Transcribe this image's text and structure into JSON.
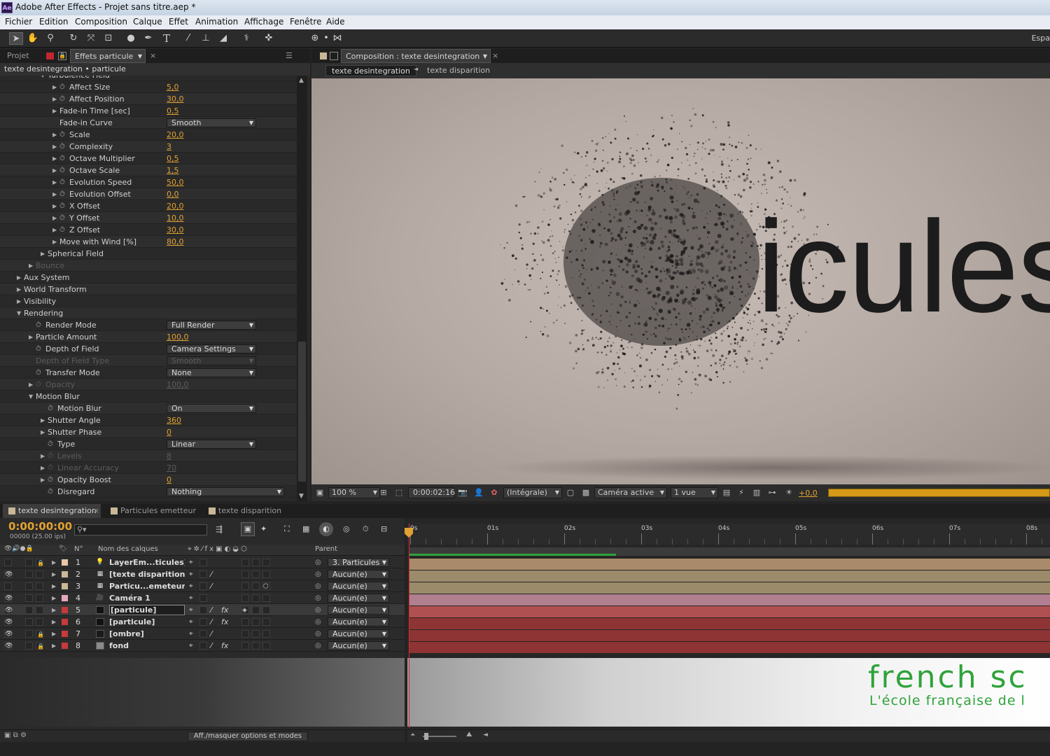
{
  "window": {
    "title": "Adobe After Effects - Projet sans titre.aep *",
    "app_icon": "Ae"
  },
  "menu": [
    "Fichier",
    "Edition",
    "Composition",
    "Calque",
    "Effet",
    "Animation",
    "Affichage",
    "Fenêtre",
    "Aide"
  ],
  "toolbar": {
    "workspace_label": "Espa"
  },
  "effects_panel": {
    "tabs": {
      "project": "Projet",
      "effects": "Effets particule"
    },
    "breadcrumb": "texte desintegration • particule",
    "partial_header": "Turbulence Field",
    "rows": [
      {
        "name": "Affect Size",
        "value": "5,0",
        "kind": "num",
        "indent": 3,
        "stopwatch": true,
        "twirl": true
      },
      {
        "name": "Affect Position",
        "value": "30,0",
        "kind": "num",
        "indent": 3,
        "stopwatch": true,
        "twirl": true
      },
      {
        "name": "Fade-in Time [sec]",
        "value": "0,5",
        "kind": "num",
        "indent": 3,
        "stopwatch": false,
        "twirl": true
      },
      {
        "name": "Fade-in Curve",
        "value": "Smooth",
        "kind": "dd",
        "indent": 3,
        "stopwatch": false,
        "twirl": false
      },
      {
        "name": "Scale",
        "value": "20,0",
        "kind": "num",
        "indent": 3,
        "stopwatch": true,
        "twirl": true
      },
      {
        "name": "Complexity",
        "value": "3",
        "kind": "num",
        "indent": 3,
        "stopwatch": true,
        "twirl": true
      },
      {
        "name": "Octave Multiplier",
        "value": "0,5",
        "kind": "num",
        "indent": 3,
        "stopwatch": true,
        "twirl": true
      },
      {
        "name": "Octave Scale",
        "value": "1,5",
        "kind": "num",
        "indent": 3,
        "stopwatch": true,
        "twirl": true
      },
      {
        "name": "Evolution Speed",
        "value": "50,0",
        "kind": "num",
        "indent": 3,
        "stopwatch": true,
        "twirl": true
      },
      {
        "name": "Evolution Offset",
        "value": "0,0",
        "kind": "num",
        "indent": 3,
        "stopwatch": true,
        "twirl": true
      },
      {
        "name": "X Offset",
        "value": "20,0",
        "kind": "num",
        "indent": 3,
        "stopwatch": true,
        "twirl": true
      },
      {
        "name": "Y Offset",
        "value": "10,0",
        "kind": "num",
        "indent": 3,
        "stopwatch": true,
        "twirl": true
      },
      {
        "name": "Z Offset",
        "value": "30,0",
        "kind": "num",
        "indent": 3,
        "stopwatch": true,
        "twirl": true
      },
      {
        "name": "Move with Wind [%]",
        "value": "80,0",
        "kind": "num",
        "indent": 3,
        "stopwatch": false,
        "twirl": true
      },
      {
        "name": "Spherical Field",
        "value": "",
        "kind": "group",
        "indent": 2,
        "stopwatch": false,
        "twirl": true
      },
      {
        "name": "Bounce",
        "value": "",
        "kind": "group",
        "indent": 1,
        "stopwatch": false,
        "twirl": true,
        "dim": true
      },
      {
        "name": "Aux System",
        "value": "",
        "kind": "group",
        "indent": 0,
        "stopwatch": false,
        "twirl": true
      },
      {
        "name": "World Transform",
        "value": "",
        "kind": "group",
        "indent": 0,
        "stopwatch": false,
        "twirl": true
      },
      {
        "name": "Visibility",
        "value": "",
        "kind": "group",
        "indent": 0,
        "stopwatch": false,
        "twirl": true
      },
      {
        "name": "Rendering",
        "value": "",
        "kind": "group",
        "indent": 0,
        "stopwatch": false,
        "twirl": true,
        "open": true
      },
      {
        "name": "Render Mode",
        "value": "Full Render",
        "kind": "dd",
        "indent": 1,
        "stopwatch": true,
        "twirl": false
      },
      {
        "name": "Particle Amount",
        "value": "100,0",
        "kind": "num",
        "indent": 1,
        "stopwatch": false,
        "twirl": true
      },
      {
        "name": "Depth of Field",
        "value": "Camera Settings",
        "kind": "dd",
        "indent": 1,
        "stopwatch": true,
        "twirl": false
      },
      {
        "name": "Depth of Field Type",
        "value": "Smooth",
        "kind": "dd",
        "indent": 1,
        "stopwatch": false,
        "twirl": false,
        "dim": true
      },
      {
        "name": "Transfer Mode",
        "value": "None",
        "kind": "dd",
        "indent": 1,
        "stopwatch": true,
        "twirl": false
      },
      {
        "name": "Opacity",
        "value": "100,0",
        "kind": "num",
        "indent": 1,
        "stopwatch": true,
        "twirl": true,
        "dim": true
      },
      {
        "name": "Motion Blur",
        "value": "",
        "kind": "group",
        "indent": 1,
        "stopwatch": false,
        "twirl": true,
        "open": true
      },
      {
        "name": "Motion Blur",
        "value": "On",
        "kind": "dd",
        "indent": 2,
        "stopwatch": true,
        "twirl": false
      },
      {
        "name": "Shutter Angle",
        "value": "360",
        "kind": "num",
        "indent": 2,
        "stopwatch": false,
        "twirl": true
      },
      {
        "name": "Shutter Phase",
        "value": "0",
        "kind": "num",
        "indent": 2,
        "stopwatch": false,
        "twirl": true
      },
      {
        "name": "Type",
        "value": "Linear",
        "kind": "dd",
        "indent": 2,
        "stopwatch": true,
        "twirl": false
      },
      {
        "name": "Levels",
        "value": "8",
        "kind": "num",
        "indent": 2,
        "stopwatch": true,
        "twirl": true,
        "dim": true
      },
      {
        "name": "Linear Accuracy",
        "value": "70",
        "kind": "num",
        "indent": 2,
        "stopwatch": true,
        "twirl": true,
        "dim": true
      },
      {
        "name": "Opacity Boost",
        "value": "0",
        "kind": "num",
        "indent": 2,
        "stopwatch": true,
        "twirl": true
      },
      {
        "name": "Disregard",
        "value": "Nothing",
        "kind": "dd",
        "indent": 2,
        "stopwatch": true,
        "twirl": false,
        "wide": true
      }
    ]
  },
  "comp_panel": {
    "tab": "Composition : texte desintegration",
    "crumbs": [
      "texte desintegration",
      "texte disparition"
    ],
    "canvas_text": "icules",
    "zoom": "100 %",
    "timecode": "0:00:02:16",
    "resolution": "(Intégrale)",
    "camera": "Caméra active",
    "views": "1 vue",
    "exposure": "+0,0"
  },
  "timeline": {
    "tabs": [
      "texte desintegration",
      "Particules emetteur",
      "texte disparition"
    ],
    "timecode": "0:00:00:00",
    "fps": "00000 (25.00 ips)",
    "search_placeholder": "",
    "col_num": "N°",
    "col_name": "Nom des calques",
    "col_parent": "Parent",
    "ruler": [
      "0s",
      "01s",
      "02s",
      "03s",
      "04s",
      "05s",
      "06s",
      "07s",
      "08s"
    ],
    "layers": [
      {
        "num": "1",
        "name": "LayerEm...ticules]",
        "icon": "light",
        "parent": "3. Particules",
        "eye": false,
        "locked": true,
        "color": "#e8c8a8",
        "thumb": "",
        "bar": "#a98a6a",
        "fx": false
      },
      {
        "num": "2",
        "name": "[texte disparition]",
        "icon": "comp",
        "parent": "Aucun(e)",
        "eye": true,
        "locked": false,
        "color": "#c9b897",
        "thumb": "",
        "bar": "#9c8b6b",
        "fx": false
      },
      {
        "num": "3",
        "name": "Particu...emeteur",
        "icon": "comp",
        "parent": "Aucun(e)",
        "eye": false,
        "locked": false,
        "color": "#c9b897",
        "thumb": "",
        "bar": "#9c8b6b",
        "fx": false
      },
      {
        "num": "4",
        "name": "Caméra 1",
        "icon": "camera",
        "parent": "Aucun(e)",
        "eye": true,
        "locked": false,
        "color": "#e5a7bd",
        "thumb": "",
        "bar": "#b27f90",
        "fx": false
      },
      {
        "num": "5",
        "name": "[particule]",
        "icon": "solid",
        "parent": "Aucun(e)",
        "eye": true,
        "locked": false,
        "color": "#c63a3a",
        "thumb": "#111111",
        "bar": "#b05050",
        "fx": true
      },
      {
        "num": "6",
        "name": "[particule]",
        "icon": "solid",
        "parent": "Aucun(e)",
        "eye": true,
        "locked": false,
        "color": "#c63a3a",
        "thumb": "#111111",
        "bar": "#8e3434",
        "fx": true
      },
      {
        "num": "7",
        "name": "[ombre]",
        "icon": "solid",
        "parent": "Aucun(e)",
        "eye": true,
        "locked": true,
        "color": "#c63a3a",
        "thumb": "#1a1a1a",
        "bar": "#8e3434",
        "fx": false
      },
      {
        "num": "8",
        "name": "fond",
        "icon": "solid",
        "parent": "Aucun(e)",
        "eye": true,
        "locked": true,
        "color": "#c63a3a",
        "thumb": "#8a8a8a",
        "bar": "#8e3434",
        "fx": true
      }
    ],
    "toggle_label": "Aff./masquer options et modes"
  },
  "watermark": {
    "line1": "french sc",
    "line2": "L'école française de l"
  },
  "colors": {
    "accent_timecode": "#e2a232",
    "work_area": "#d49a18",
    "cti": "#d62b2b",
    "watermark": "#2fa33a"
  }
}
